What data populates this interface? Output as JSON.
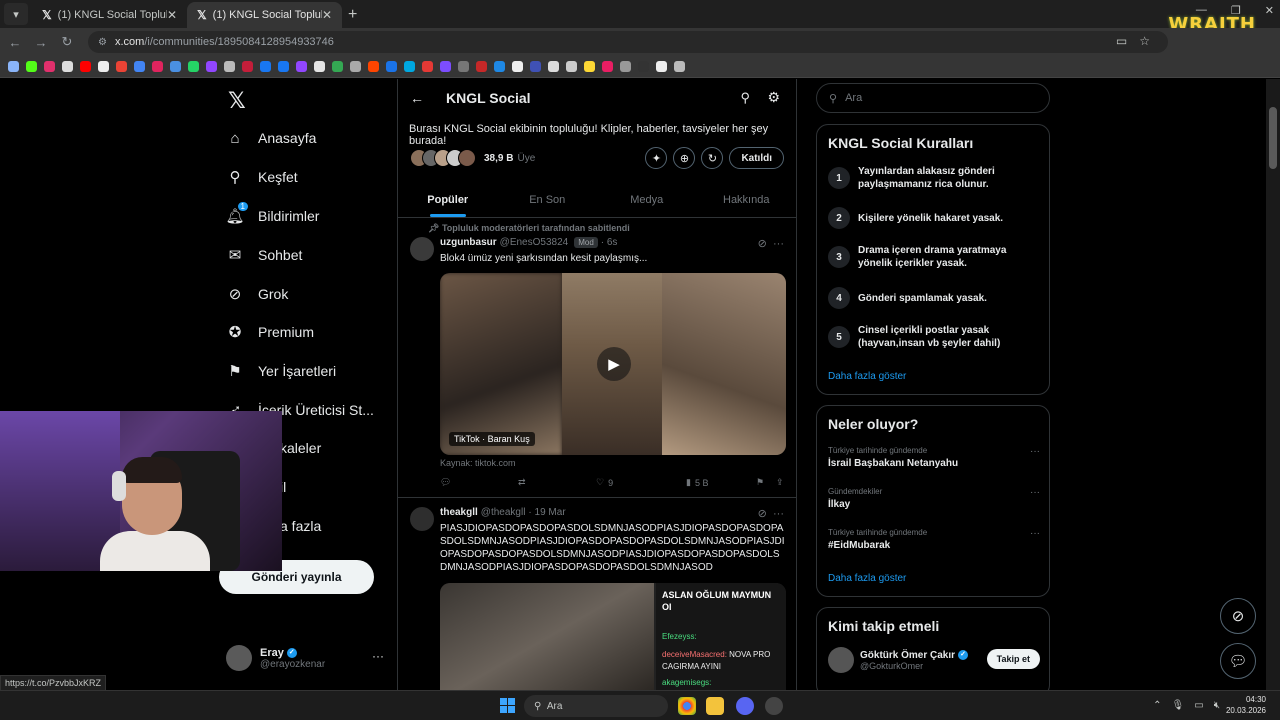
{
  "browser": {
    "tabs": [
      {
        "title": "(1) KNGL Social Topluluk / X",
        "active": false
      },
      {
        "title": "(1) KNGL Social Topluluk / X",
        "active": true
      }
    ],
    "url_host": "x.com",
    "url_path": "/i/communities/1895084128954933746",
    "overlay_logo": "WRAITH",
    "status_url": "https://t.co/PzvbbJxKRZ"
  },
  "nav": {
    "items": [
      {
        "label": "Anasayfa",
        "icon": "home-icon"
      },
      {
        "label": "Keşfet",
        "icon": "search-icon"
      },
      {
        "label": "Bildirimler",
        "icon": "bell-icon",
        "badge": "1"
      },
      {
        "label": "Sohbet",
        "icon": "mail-icon"
      },
      {
        "label": "Grok",
        "icon": "grok-icon"
      },
      {
        "label": "Premium",
        "icon": "premium-icon"
      },
      {
        "label": "Yer İşaretleri",
        "icon": "bookmark-icon"
      },
      {
        "label": "İçerik Üreticisi St...",
        "icon": "rocket-icon"
      },
      {
        "label": "kaleler",
        "icon": "article-icon"
      },
      {
        "label": "il",
        "icon": "profile-icon"
      },
      {
        "label": "a fazla",
        "icon": "more-icon"
      }
    ],
    "post_button": "Gönderi yayınla",
    "profile": {
      "name": "Eray",
      "handle": "@erayozkenar"
    }
  },
  "community": {
    "title": "KNGL Social",
    "description": "Burası KNGL Social ekibinin topluluğu! Klipler, haberler, tavsiyeler her şey burada!",
    "member_count": "38,9 B",
    "member_label": "Üye",
    "joined_label": "Katıldı",
    "tabs": [
      "Popüler",
      "En Son",
      "Medya",
      "Hakkında"
    ],
    "active_tab": "Popüler"
  },
  "posts": [
    {
      "pinned_label": "Topluluk moderatörleri tarafından sabitlendi",
      "name": "uzgunbasur",
      "handle": "@EnesO53824",
      "badge": "Mod",
      "time": "· 6s",
      "text": "Blok4 ümüz yeni şarkısından kesit paylaşmış...",
      "video_label": "TikTok · Baran Kuş",
      "source": "Kaynak: tiktok.com",
      "likes": "9",
      "views": "5 B"
    },
    {
      "name": "theakgll",
      "handle": "@theakgll",
      "time": "· 19 Mar",
      "text": "PIASJDIOPASDOPASDOPASDOLSDMNJASODPIASJDIOPASDOPASDOPASDOLSDMNJASODPIASJDIOPASDOPASDOPASDOLSDMNJASODPIASJDIOPASDOPASDOPASDOLSDMNJASODPIASJDIOPASDOPASDOPASDOLSDMNJASODPIASJDIOPASDOPASDOPASDOLSDMNJASOD",
      "chat_title": "ASLAN OĞLUM MAYMUN OI",
      "chat_lines": [
        {
          "user": "Efezeyss:",
          "msg": ""
        },
        {
          "user": "deceiveMasacred:",
          "msg": "NOVA PRO CAGIRMA AYINI"
        },
        {
          "user": "akagemisegs:",
          "msg": ""
        }
      ]
    }
  ],
  "sidebar": {
    "search_placeholder": "Ara",
    "rules_title": "KNGL Social Kuralları",
    "rules": [
      {
        "num": "1",
        "text": "Yayınlardan alakasız gönderi paylaşmamanız rica olunur."
      },
      {
        "num": "2",
        "text": "Kişilere yönelik hakaret yasak."
      },
      {
        "num": "3",
        "text": "Drama içeren drama yaratmaya yönelik içerikler yasak."
      },
      {
        "num": "4",
        "text": "Gönderi spamlamak yasak."
      },
      {
        "num": "5",
        "text": "Cinsel içerikli postlar yasak (hayvan,insan vb şeyler dahil)"
      }
    ],
    "show_more": "Daha fazla göster",
    "trends_title": "Neler oluyor?",
    "trends": [
      {
        "context": "Türkiye tarihinde gündemde",
        "name": "İsrail Başbakanı Netanyahu"
      },
      {
        "context": "Gündemdekiler",
        "name": "İlkay"
      },
      {
        "context": "Türkiye tarihinde gündemde",
        "name": "#EidMubarak"
      }
    ],
    "trends_more": "Daha fazla göster",
    "follow_title": "Kimi takip etmeli",
    "follow": {
      "name": "Göktürk Ömer Çakır",
      "handle": "@GokturkOmer",
      "button": "Takip et"
    }
  },
  "taskbar": {
    "search_placeholder": "Ara",
    "time": "04:30",
    "date": "20.03.2026"
  },
  "colors": {
    "accent": "#1d9bf0",
    "background": "#000000",
    "border": "#2f3336",
    "muted_text": "#71767b"
  }
}
